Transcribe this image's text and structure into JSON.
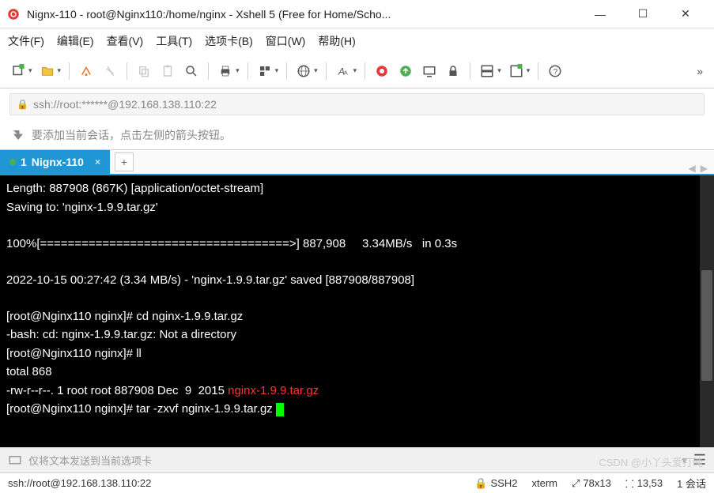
{
  "titlebar": {
    "title": "Nignx-110 - root@Nginx110:/home/nginx - Xshell 5 (Free for Home/Scho..."
  },
  "menu": {
    "file": "文件(F)",
    "edit": "编辑(E)",
    "view": "查看(V)",
    "tools": "工具(T)",
    "tab": "选项卡(B)",
    "window": "窗口(W)",
    "help": "帮助(H)"
  },
  "address": {
    "url": "ssh://root:******@192.168.138.110:22"
  },
  "hint": {
    "text": "要添加当前会话，点击左侧的箭头按钮。"
  },
  "tabs": {
    "active": {
      "index": "1",
      "label": "Nignx-110"
    }
  },
  "terminal": {
    "line1": "Length: 887908 (867K) [application/octet-stream]",
    "line2": "Saving to: 'nginx-1.9.9.tar.gz'",
    "line3": "100%[====================================>] 887,908     3.34MB/s   in 0.3s",
    "line4": "2022-10-15 00:27:42 (3.34 MB/s) - 'nginx-1.9.9.tar.gz' saved [887908/887908]",
    "prompt1": "[root@Nginx110 nginx]# ",
    "cmd1": "cd nginx-1.9.9.tar.gz",
    "err1": "-bash: cd: nginx-1.9.9.tar.gz: Not a directory",
    "prompt2": "[root@Nginx110 nginx]# ",
    "cmd2": "ll",
    "total": "total 868",
    "ls_perm": "-rw-r--r--. 1 root root 887908 Dec  9  2015 ",
    "ls_file": "nginx-1.9.9.tar.gz",
    "prompt3": "[root@Nginx110 nginx]# ",
    "cmd3": "tar -zxvf nginx-1.9.9.tar.gz "
  },
  "sendbar": {
    "placeholder": "仅将文本发送到当前选项卡"
  },
  "status": {
    "conn": "ssh://root@192.168.138.110:22",
    "proto": "SSH2",
    "term": "xterm",
    "size": "78x13",
    "pos": "13,53",
    "session": "1 会话"
  },
  "watermark": "CSDN @小丫头爱打盹"
}
